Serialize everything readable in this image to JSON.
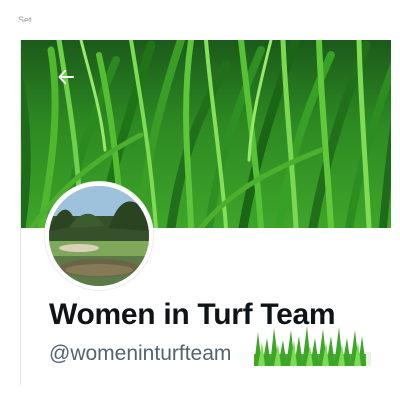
{
  "status_fragment": "Set",
  "header": {
    "back_icon": "arrow-left-icon"
  },
  "banner": {
    "image": "grass-banner"
  },
  "profile": {
    "avatar_image": "golf-course-avatar",
    "display_name": "Women in Turf Team",
    "handle": "@womeninturfteam"
  },
  "sticker": {
    "image": "grass-sticker"
  },
  "colors": {
    "name_text": "#0f1419",
    "handle_text": "#536471",
    "grass_dark": "#1b5a1b",
    "grass_light": "#3ea52a"
  }
}
